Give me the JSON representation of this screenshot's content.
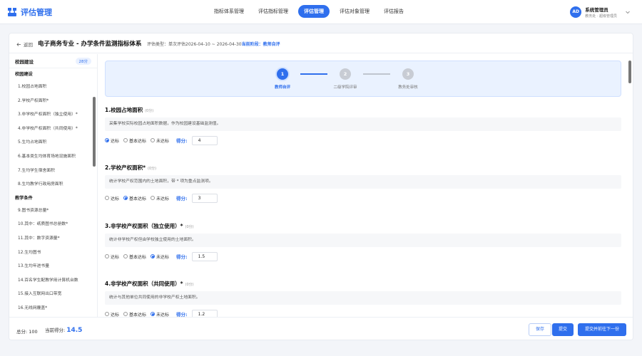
{
  "app": {
    "name": "评估管理",
    "logo_icon": "org-chart-icon"
  },
  "nav": [
    {
      "label": "指标体系管理",
      "active": false
    },
    {
      "label": "评估指标管理",
      "active": false
    },
    {
      "label": "评估管理",
      "active": true
    },
    {
      "label": "评估对象管理",
      "active": false
    },
    {
      "label": "评估报告",
      "active": false
    }
  ],
  "user": {
    "initials": "AD",
    "name": "系统管理员",
    "role": "教务处 · 超级管理员"
  },
  "header": {
    "back_label": "返回",
    "title": "电子商务专业 - 办学条件监测指标体系",
    "meta_prefix": "评估类型：单次评估2026-04-10 ~ 2026-04-30",
    "stage_label": "当前阶段：教师自评"
  },
  "sidebar": {
    "title": "校园建设",
    "badge": "28分",
    "groups": [
      {
        "name": "校园建设",
        "items": [
          "1.校园占地面积",
          "2.学校产权面积*",
          "3.非学校产权面积（独立使用）*",
          "4.非学校产权面积（共同使用）*",
          "5.生均占地面积",
          "6.基本类生均体育场地设施面积",
          "7.生均学生宿舍面积",
          "8.生均教学行政用房面积"
        ]
      },
      {
        "name": "教学条件",
        "items": [
          "9.图书资源总量*",
          "10.其中：纸质图书总册数*",
          "11.其中：数字资源量*",
          "12.生均图书",
          "13.生均年进书量",
          "14.百名学生配教学用计算机台数",
          "15.接入互联网出口带宽",
          "16.无线网覆盖*"
        ]
      }
    ]
  },
  "steps": [
    {
      "num": "1",
      "label": "教师自评",
      "active": true
    },
    {
      "num": "2",
      "label": "二级学院评审",
      "active": false
    },
    {
      "num": "3",
      "label": "教务处审核",
      "active": false
    }
  ],
  "options": [
    "达标",
    "基本达标",
    "未达标"
  ],
  "score_label": "得分:",
  "questions": [
    {
      "title": "1.校园占地面积",
      "score": "(0分)",
      "desc": "采集学校实际校园占地面积数据，作为校园建设基础监测值。",
      "selected": 0,
      "value": "4"
    },
    {
      "title": "2.学校产权面积*",
      "score": "(0分)",
      "desc": "统计学校产权范围内的土地面积，带 * 项为重点监测项。",
      "selected": 1,
      "value": "3"
    },
    {
      "title": "3.非学校产权面积（独立使用）*",
      "score": "(0分)",
      "desc": "统计非学校产权但由学校独立使用的土地面积。",
      "selected": 2,
      "value": "1.5"
    },
    {
      "title": "4.非学校产权面积（共同使用）*",
      "score": "(0分)",
      "desc": "统计与其他单位共同使用的非学校产权土地面积。",
      "selected": 2,
      "value": "1.2"
    }
  ],
  "footer": {
    "total_label": "总分: 100",
    "current_label": "当前得分:",
    "current_value": "14.5",
    "save_label": "保存",
    "submit_label": "提交",
    "next_label": "提交并前往下一份"
  },
  "colors": {
    "accent": "#2f6fed"
  }
}
